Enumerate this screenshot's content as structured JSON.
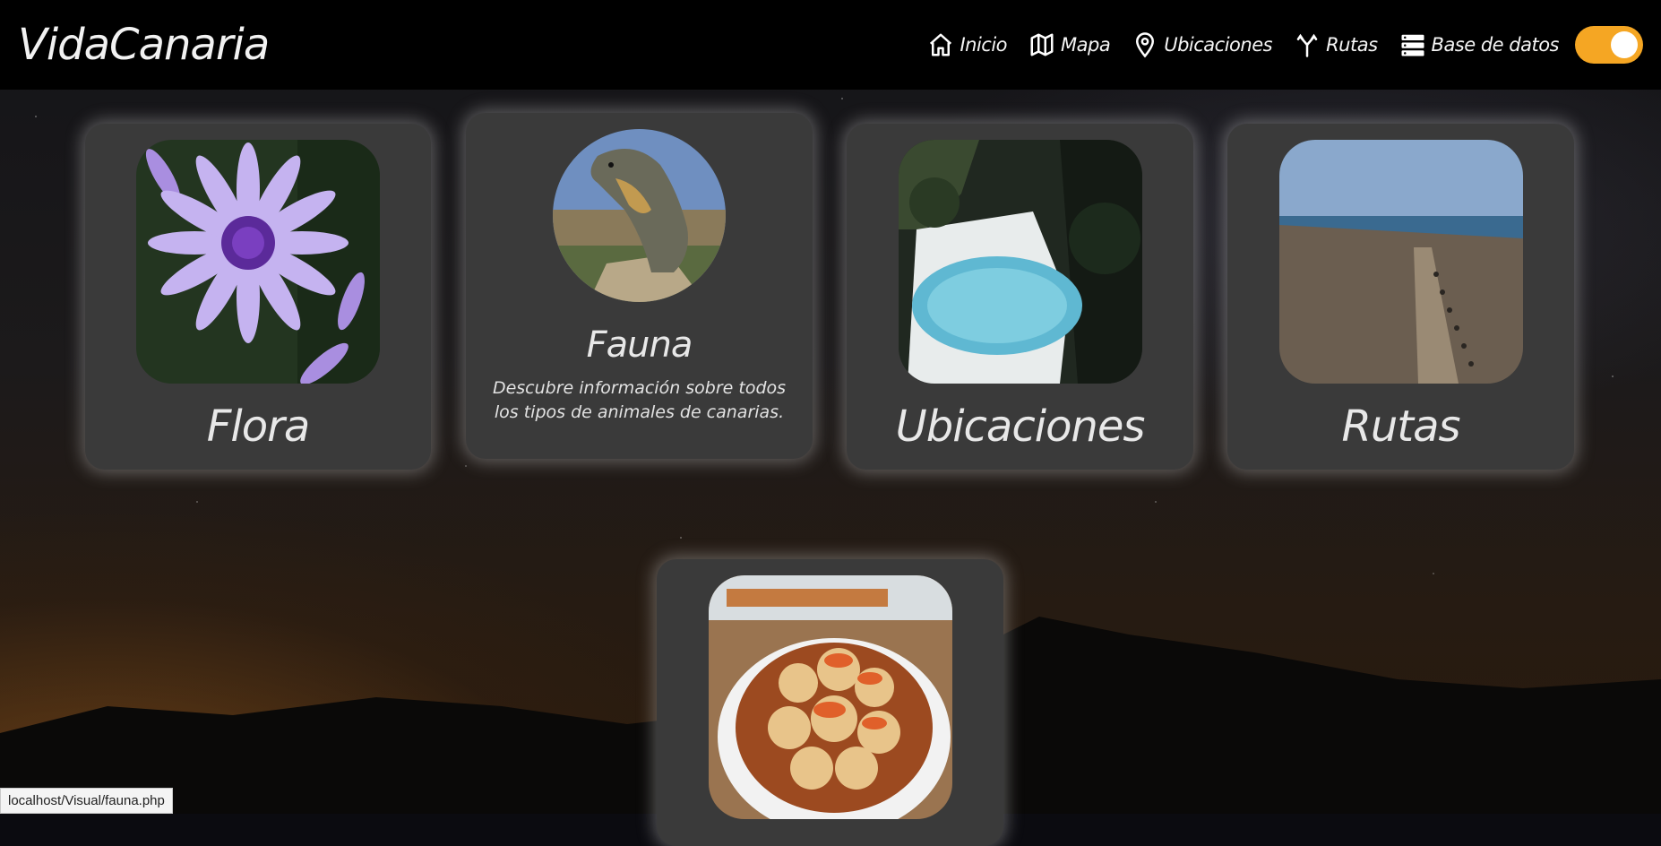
{
  "brand": "VidaCanaria",
  "nav": {
    "items": [
      {
        "label": "Inicio",
        "icon": "home-icon"
      },
      {
        "label": "Mapa",
        "icon": "map-icon"
      },
      {
        "label": "Ubicaciones",
        "icon": "location-pin-icon"
      },
      {
        "label": "Rutas",
        "icon": "route-fork-icon"
      },
      {
        "label": "Base de datos",
        "icon": "database-icon"
      }
    ],
    "theme_toggle": {
      "state": "on",
      "color": "#f5a623"
    }
  },
  "cards": {
    "flora": {
      "title": "Flora"
    },
    "fauna": {
      "title": "Fauna",
      "description": "Descubre información sobre todos los tipos de animales de canarias."
    },
    "ubicaciones": {
      "title": "Ubicaciones"
    },
    "rutas": {
      "title": "Rutas"
    },
    "gastronomia": {
      "title": ""
    }
  },
  "status_bar": {
    "url": "localhost/Visual/fauna.php"
  }
}
